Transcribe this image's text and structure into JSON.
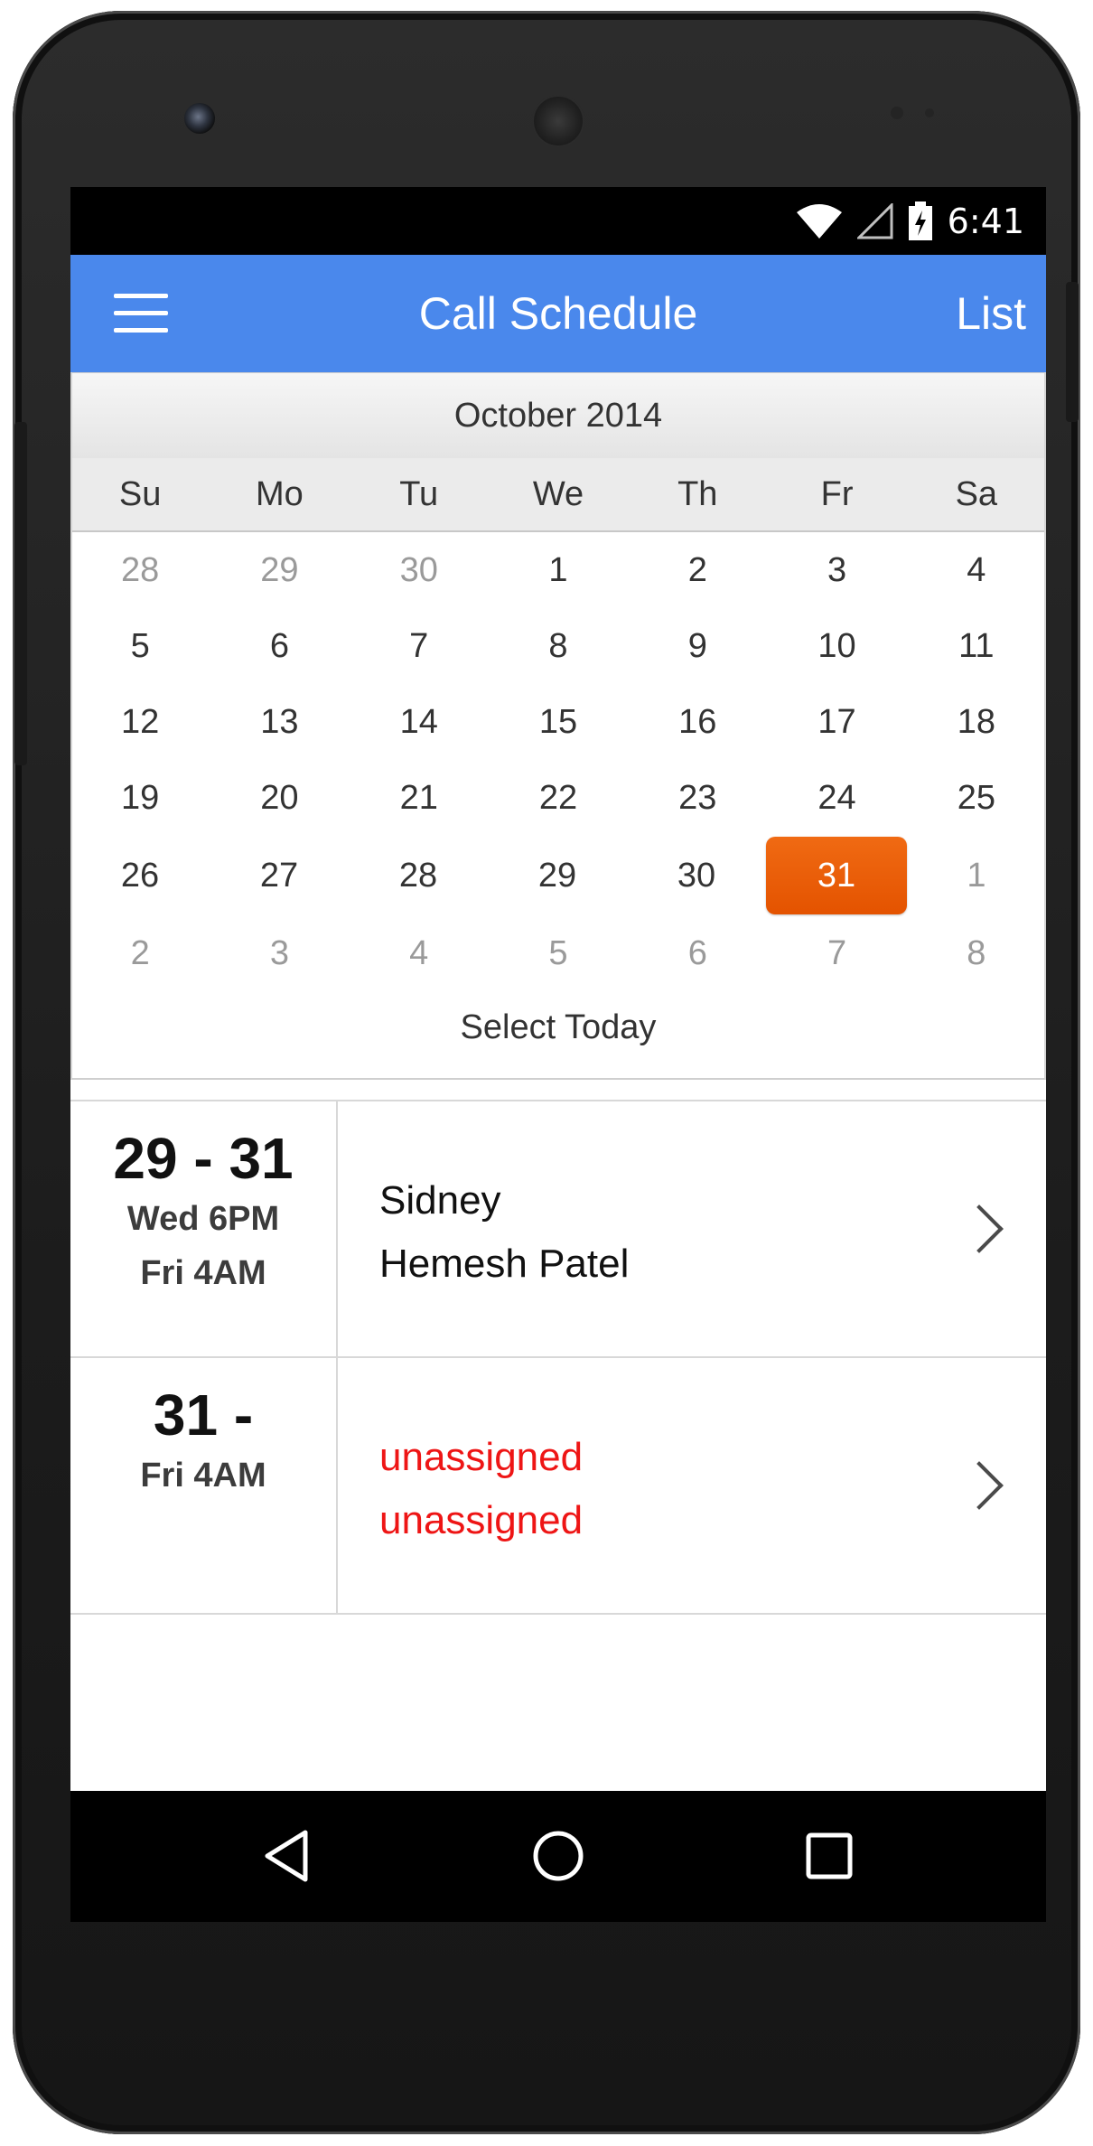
{
  "status_bar": {
    "time": "6:41",
    "icons": [
      "wifi-icon",
      "cell-signal-icon",
      "battery-charging-icon"
    ]
  },
  "app_bar": {
    "menu_icon": "hamburger-menu-icon",
    "title": "Call Schedule",
    "action_label": "List"
  },
  "calendar": {
    "month_label": "October 2014",
    "weekdays": [
      "Su",
      "Mo",
      "Tu",
      "We",
      "Th",
      "Fr",
      "Sa"
    ],
    "weeks": [
      [
        {
          "day": "28",
          "muted": true
        },
        {
          "day": "29",
          "muted": true
        },
        {
          "day": "30",
          "muted": true
        },
        {
          "day": "1"
        },
        {
          "day": "2"
        },
        {
          "day": "3"
        },
        {
          "day": "4"
        }
      ],
      [
        {
          "day": "5"
        },
        {
          "day": "6"
        },
        {
          "day": "7"
        },
        {
          "day": "8"
        },
        {
          "day": "9"
        },
        {
          "day": "10"
        },
        {
          "day": "11"
        }
      ],
      [
        {
          "day": "12"
        },
        {
          "day": "13"
        },
        {
          "day": "14"
        },
        {
          "day": "15"
        },
        {
          "day": "16"
        },
        {
          "day": "17"
        },
        {
          "day": "18"
        }
      ],
      [
        {
          "day": "19"
        },
        {
          "day": "20"
        },
        {
          "day": "21"
        },
        {
          "day": "22"
        },
        {
          "day": "23"
        },
        {
          "day": "24"
        },
        {
          "day": "25"
        }
      ],
      [
        {
          "day": "26"
        },
        {
          "day": "27"
        },
        {
          "day": "28"
        },
        {
          "day": "29"
        },
        {
          "day": "30"
        },
        {
          "day": "31",
          "selected": true
        },
        {
          "day": "1",
          "muted": true
        }
      ],
      [
        {
          "day": "2",
          "muted": true
        },
        {
          "day": "3",
          "muted": true
        },
        {
          "day": "4",
          "muted": true
        },
        {
          "day": "5",
          "muted": true
        },
        {
          "day": "6",
          "muted": true
        },
        {
          "day": "7",
          "muted": true
        },
        {
          "day": "8",
          "muted": true
        }
      ]
    ],
    "select_today_label": "Select Today",
    "selected_color": "#e85a06"
  },
  "schedule": [
    {
      "date_range": "29 - 31",
      "time_lines": [
        "Wed 6PM",
        "Fri 4AM"
      ],
      "names": [
        {
          "text": "Sidney",
          "unassigned": false
        },
        {
          "text": "Hemesh Patel",
          "unassigned": false
        }
      ]
    },
    {
      "date_range": "31 -",
      "time_lines": [
        "Fri 4AM"
      ],
      "names": [
        {
          "text": "unassigned",
          "unassigned": true
        },
        {
          "text": "unassigned",
          "unassigned": true
        }
      ]
    }
  ],
  "nav_bar": {
    "buttons": [
      "back-icon",
      "home-icon",
      "recents-icon"
    ]
  },
  "colors": {
    "app_bar": "#4a88ec",
    "unassigned": "#ee1515"
  }
}
